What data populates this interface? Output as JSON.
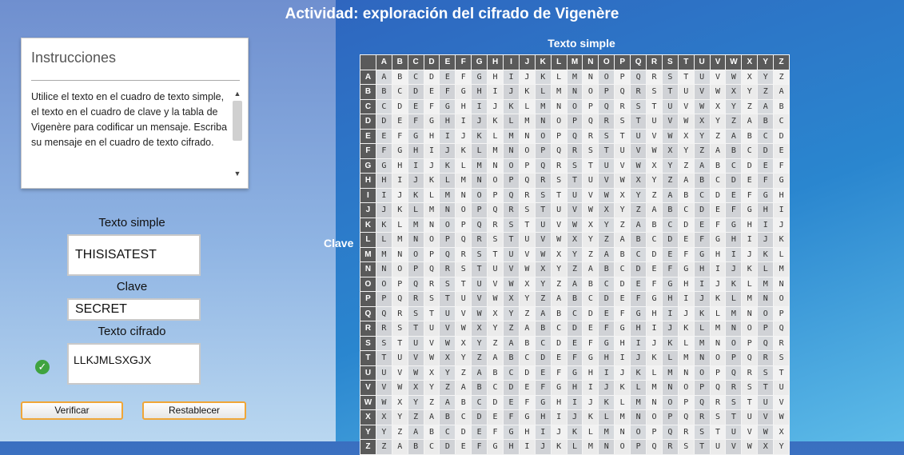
{
  "page": {
    "title": "Actividad: exploración del cifrado de Vigenère"
  },
  "instructions": {
    "heading": "Instrucciones",
    "text": "Utilice el texto en el cuadro de texto simple, el texto en el cuadro de clave y la tabla de Vigenère para codificar un mensaje. Escriba su mensaje en el cuadro de texto cifrado."
  },
  "form": {
    "plaintext_label": "Texto simple",
    "plaintext_value": "THISISATEST",
    "key_label": "Clave",
    "key_value": "SECRET",
    "ciphertext_label": "Texto cifrado",
    "ciphertext_value": "LLKJMLSXGJX",
    "verify_label": "Verificar",
    "reset_label": "Restablecer",
    "status_icon": "check-icon",
    "status_color": "#3fa33f"
  },
  "table": {
    "top_label": "Texto simple",
    "side_label": "Clave",
    "letters": [
      "A",
      "B",
      "C",
      "D",
      "E",
      "F",
      "G",
      "H",
      "I",
      "J",
      "K",
      "L",
      "M",
      "N",
      "O",
      "P",
      "Q",
      "R",
      "S",
      "T",
      "U",
      "V",
      "W",
      "X",
      "Y",
      "Z"
    ]
  }
}
